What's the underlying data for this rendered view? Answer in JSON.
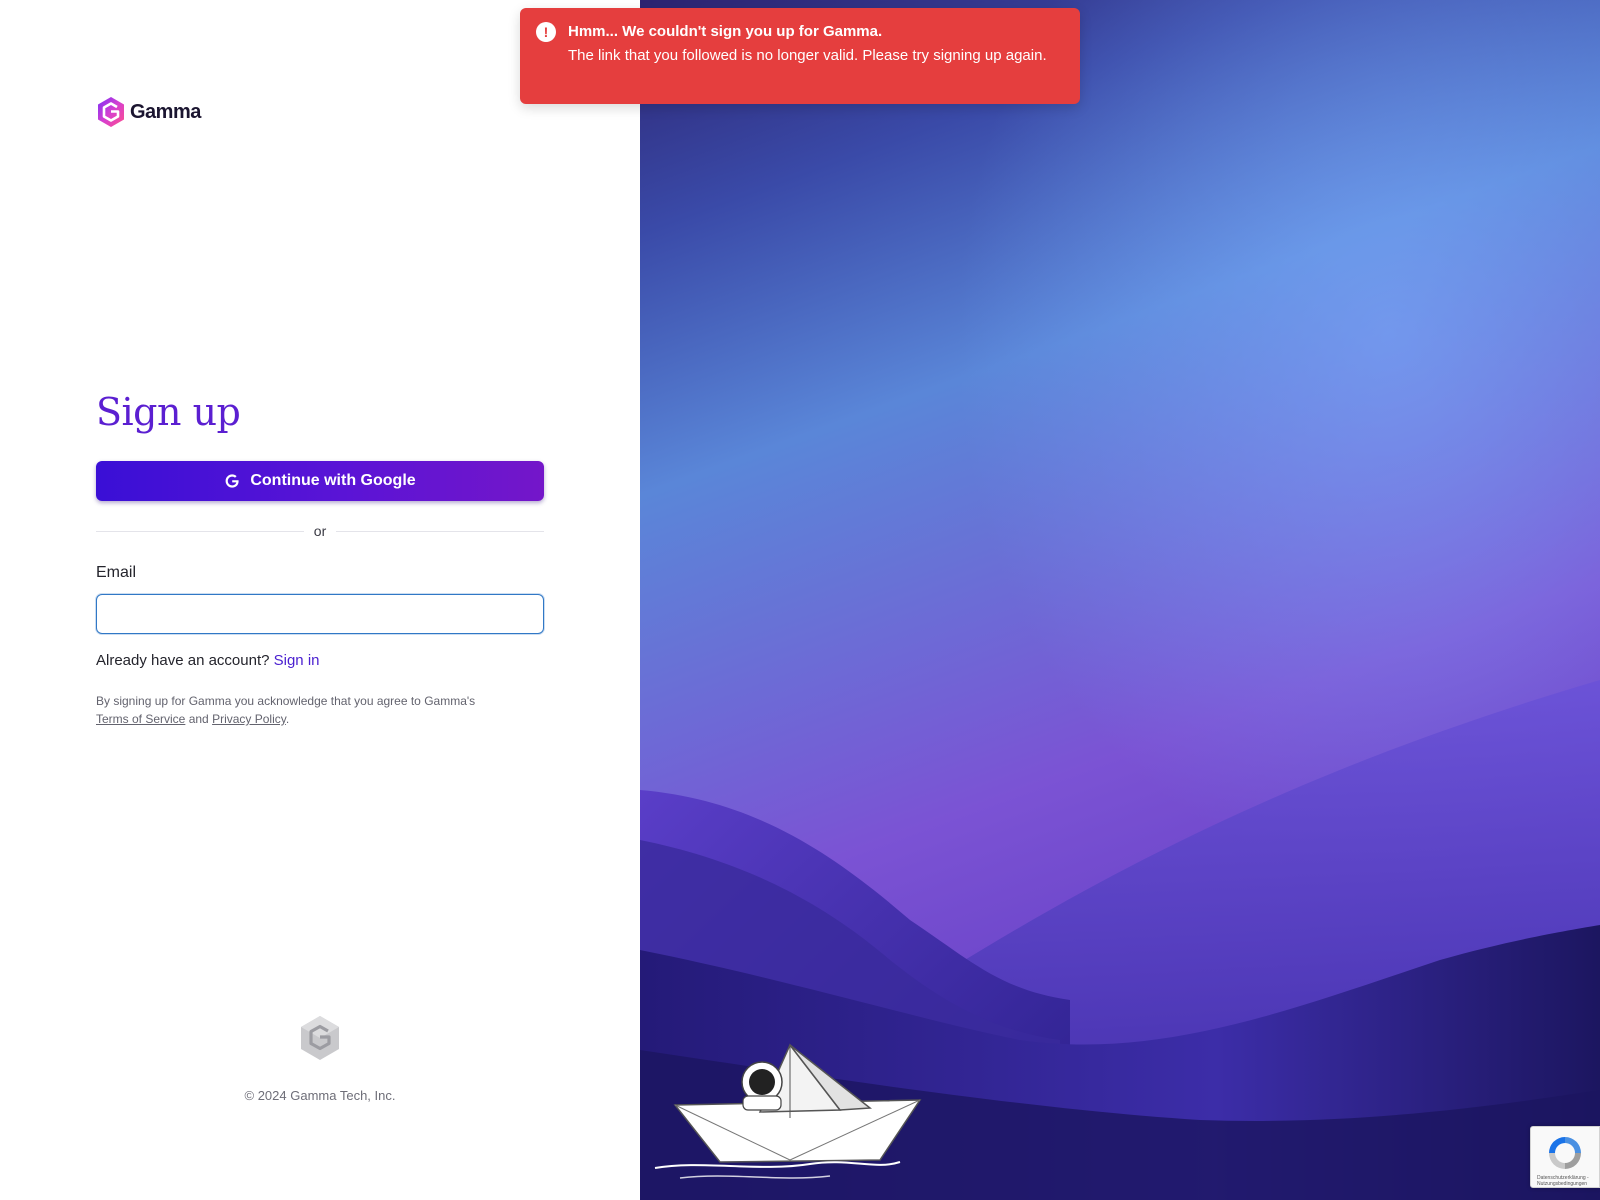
{
  "brand": {
    "name": "Gamma"
  },
  "toast": {
    "title": "Hmm... We couldn't sign you up for Gamma.",
    "message": "The link that you followed is no longer valid. Please try signing up again.",
    "color": "#e53e3e",
    "icon": "alert-icon"
  },
  "signup": {
    "heading": "Sign up",
    "google_button": "Continue with Google",
    "divider_text": "or",
    "email_label": "Email",
    "email_value": "",
    "already_text": "Already have an account?",
    "signin_link": "Sign in",
    "legal_prefix": "By signing up for Gamma you acknowledge that you agree to Gamma's",
    "terms_link": "Terms of Service",
    "legal_and": "and",
    "privacy_link": "Privacy Policy",
    "legal_suffix": "."
  },
  "footer": {
    "copyright": "© 2024 Gamma Tech, Inc."
  },
  "recaptcha": {
    "text": "Datenschutzerklärung - Nutzungsbedingungen"
  },
  "colors": {
    "accent": "#5b1fd1",
    "link": "#4a1fd0",
    "input_focus": "#3178c6"
  }
}
